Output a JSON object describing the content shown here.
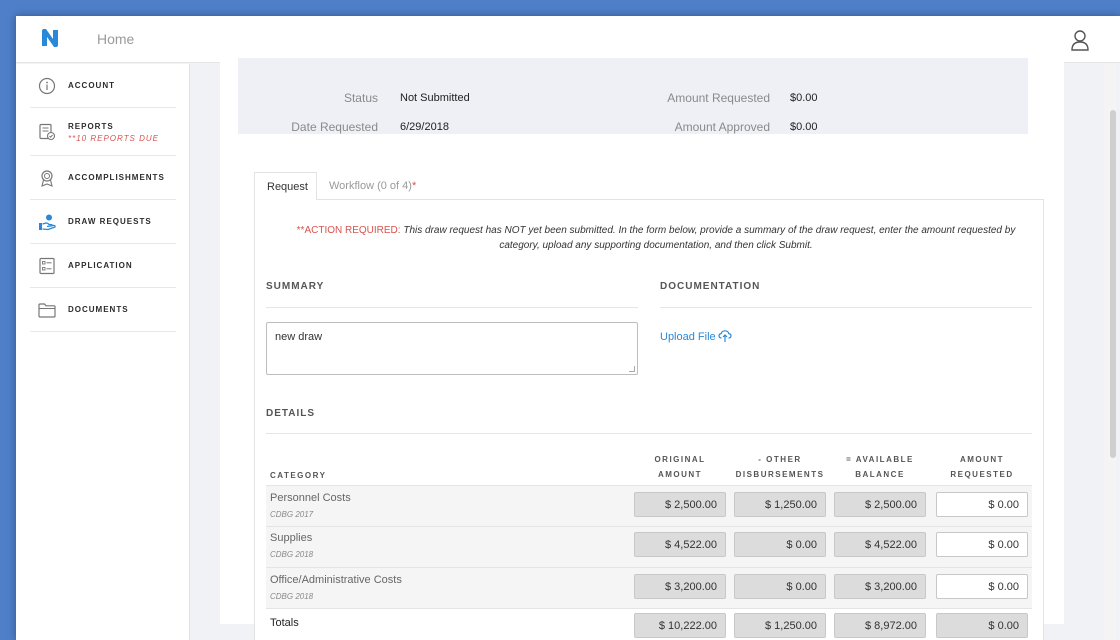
{
  "nav": {
    "home_label": "Home"
  },
  "sidebar": {
    "items": [
      {
        "label": "ACCOUNT",
        "icon": "info-icon"
      },
      {
        "label": "REPORTS",
        "sub": "**10 REPORTS DUE",
        "icon": "report-check-icon"
      },
      {
        "label": "ACCOMPLISHMENTS",
        "icon": "award-ribbon-icon"
      },
      {
        "label": "DRAW REQUESTS",
        "icon": "hand-money-icon",
        "active_color": "#2a88d8"
      },
      {
        "label": "APPLICATION",
        "icon": "checklist-icon"
      },
      {
        "label": "DOCUMENTS",
        "icon": "folder-icon"
      }
    ]
  },
  "status": {
    "status_label": "Status",
    "status_value": "Not Submitted",
    "date_label": "Date Requested",
    "date_value": "6/29/2018",
    "amount_requested_label": "Amount Requested",
    "amount_requested_value": "$0.00",
    "amount_approved_label": "Amount Approved",
    "amount_approved_value": "$0.00"
  },
  "tabs": {
    "request": "Request",
    "workflow": "Workflow (0 of 4)",
    "workflow_mark": "*"
  },
  "alert": {
    "flag": "**ACTION REQUIRED:",
    "text": "This draw request has NOT yet been submitted.  In the form below, provide a summary of the draw request, enter the amount requested by category, upload any supporting documentation, and then click Submit."
  },
  "summary": {
    "heading": "SUMMARY",
    "value": "new draw"
  },
  "documentation": {
    "heading": "DOCUMENTATION",
    "upload_label": "Upload File"
  },
  "details": {
    "heading": "DETAILS",
    "columns": {
      "category": "CATEGORY",
      "original_1": "ORIGINAL",
      "original_2": "AMOUNT",
      "other_1": "- OTHER",
      "other_2": "DISBURSEMENTS",
      "available_1": "= AVAILABLE",
      "available_2": "BALANCE",
      "requested_1": "AMOUNT",
      "requested_2": "REQUESTED"
    },
    "rows": [
      {
        "name": "Personnel Costs",
        "sub": "CDBG 2017",
        "original": "$ 2,500.00",
        "other": "$ 1,250.00",
        "available": "$ 2,500.00",
        "requested": "$ 0.00"
      },
      {
        "name": "Supplies",
        "sub": "CDBG 2018",
        "original": "$ 4,522.00",
        "other": "$ 0.00",
        "available": "$ 4,522.00",
        "requested": "$ 0.00"
      },
      {
        "name": "Office/Administrative Costs",
        "sub": "CDBG 2018",
        "original": "$ 3,200.00",
        "other": "$ 0.00",
        "available": "$ 3,200.00",
        "requested": "$ 0.00"
      }
    ],
    "totals": {
      "label": "Totals",
      "original": "$ 10,222.00",
      "other": "$ 1,250.00",
      "available": "$ 8,972.00",
      "requested": "$ 0.00"
    }
  },
  "colors": {
    "brand": "#2a88d8",
    "alert": "#d9534f",
    "frame": "#4f7fc9"
  }
}
